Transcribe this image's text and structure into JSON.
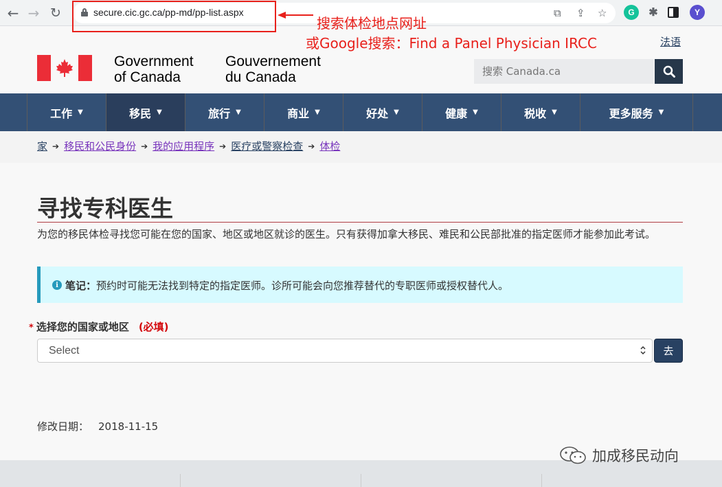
{
  "browser": {
    "url": "secure.cic.gc.ca/pp-md/pp-list.aspx",
    "profile_initial": "Y",
    "grammarly_initial": "G"
  },
  "annotations": {
    "line1": "搜索体检地点网址",
    "line2": "或Google搜索：Find a Panel Physician IRCC",
    "color": "#e8201b"
  },
  "header": {
    "language_link": "法语",
    "gov_en_line1": "Government",
    "gov_en_line2": "of Canada",
    "gov_fr_line1": "Gouvernement",
    "gov_fr_line2": "du Canada",
    "search_placeholder": "搜索 Canada.ca"
  },
  "menu": {
    "items": [
      {
        "label": "工作"
      },
      {
        "label": "移民"
      },
      {
        "label": "旅行"
      },
      {
        "label": "商业"
      },
      {
        "label": "好处"
      },
      {
        "label": "健康"
      },
      {
        "label": "税收"
      },
      {
        "label": "更多服务"
      }
    ],
    "active_index": 1
  },
  "breadcrumb": [
    {
      "label": "家"
    },
    {
      "label": "移民和公民身份"
    },
    {
      "label": "我的应用程序"
    },
    {
      "label": "医疗或警察检查"
    },
    {
      "label": "体检"
    }
  ],
  "main": {
    "title": "寻找专科医生",
    "intro": "为您的移民体检寻找您可能在您的国家、地区或地区就诊的医生。只有获得加拿大移民、难民和公民部批准的指定医师才能参加此考试。",
    "note_label": "笔记：",
    "note_text": "预约时可能无法找到特定的指定医师。诊所可能会向您推荐替代的专职医师或授权替代人。",
    "field_star": "*",
    "field_label": "选择您的国家或地区",
    "field_required": "(必填)",
    "select_value": "Select",
    "go_button": "去",
    "modified_label": "修改日期：",
    "modified_date": "2018-11-15"
  },
  "watermark": "加成移民动向",
  "colors": {
    "menu_bg": "#335075",
    "menu_active": "#2a3e5c",
    "title_rule": "#af3c43",
    "note_bg": "#d7faff",
    "note_border": "#269abc",
    "required": "#d3080c",
    "link": "#284162",
    "visited_link": "#7834bc",
    "flag_red": "#eb2d37"
  }
}
